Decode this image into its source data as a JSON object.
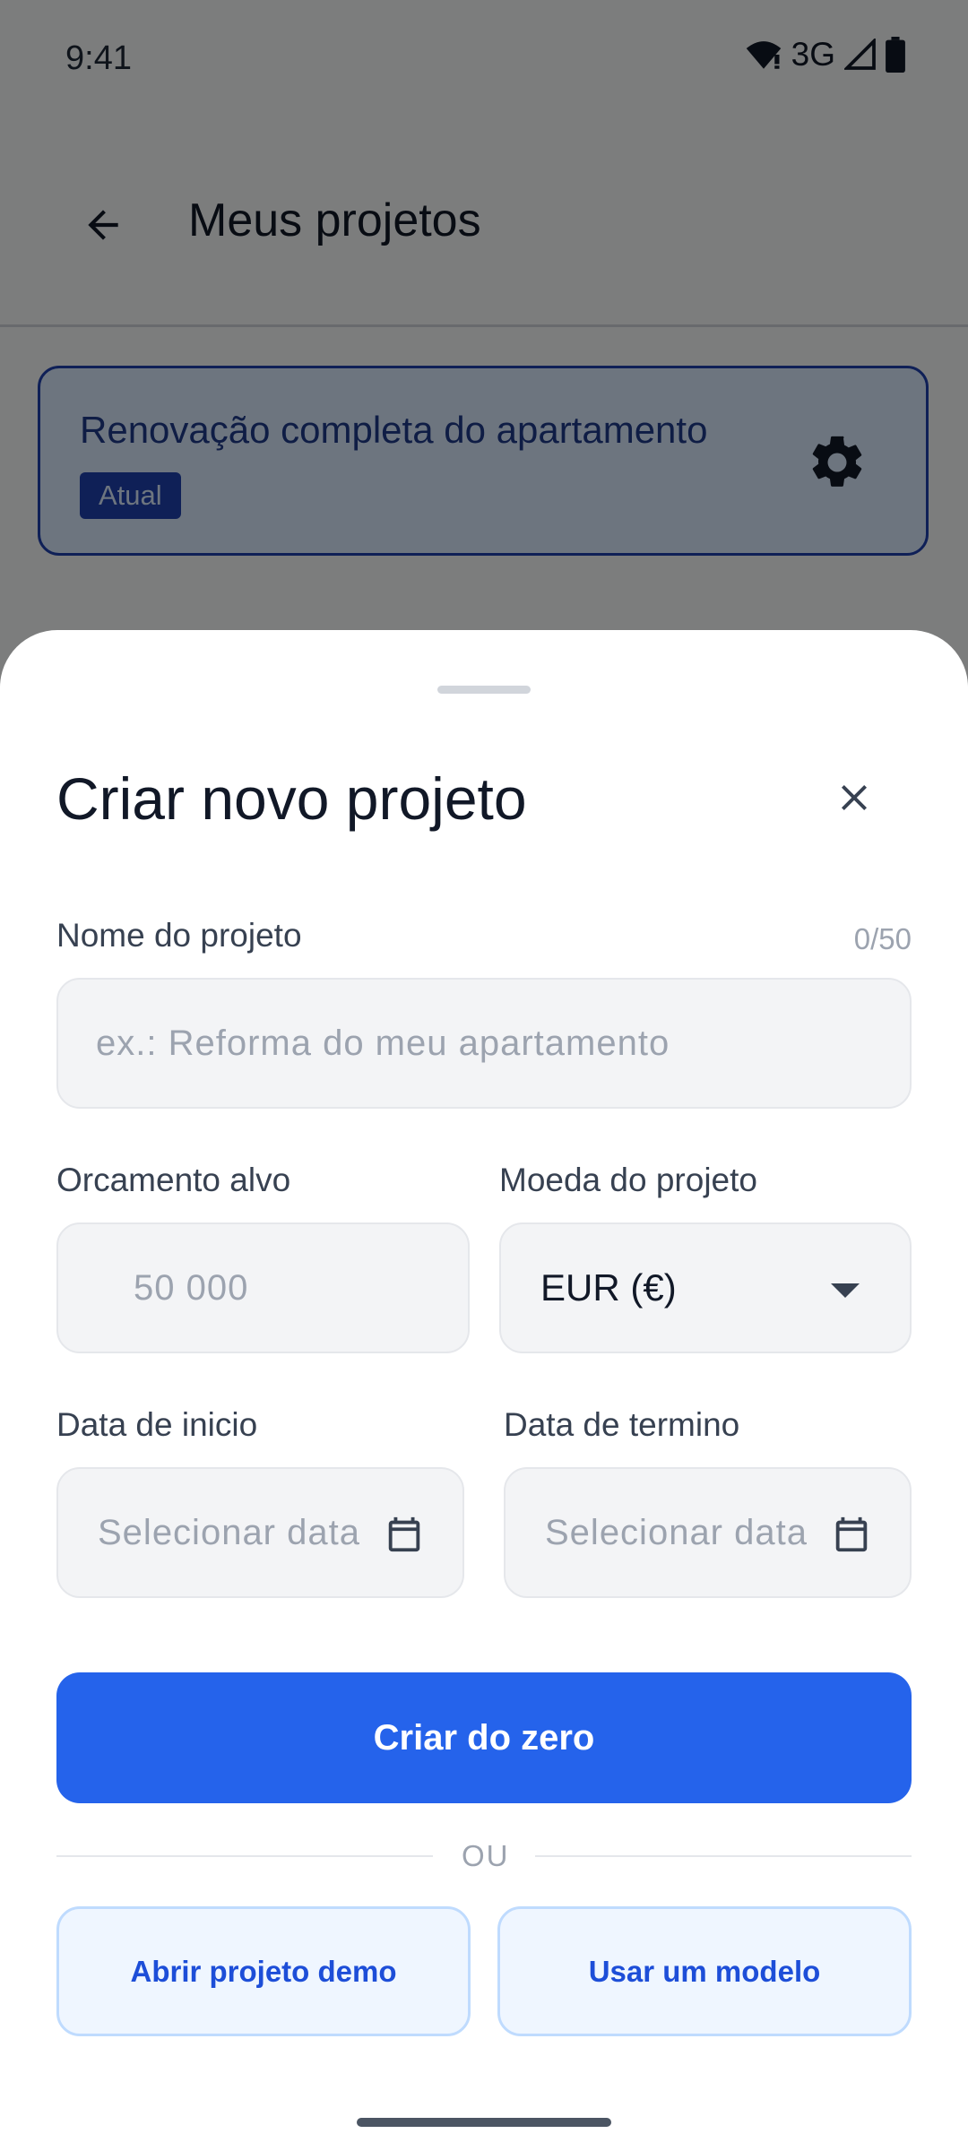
{
  "status_bar": {
    "time": "9:41",
    "network": "3G"
  },
  "background": {
    "app_bar": {
      "title": "Meus projetos"
    },
    "project_card": {
      "name": "Renovação completa do apartamento",
      "badge": "Atual"
    }
  },
  "sheet": {
    "title": "Criar novo projeto",
    "project_name": {
      "label": "Nome do projeto",
      "counter": "0/50",
      "placeholder": "ex.: Reforma do meu apartamento",
      "value": ""
    },
    "budget": {
      "label": "Orcamento alvo",
      "placeholder": "50 000",
      "value": ""
    },
    "currency": {
      "label": "Moeda do projeto",
      "selected": "EUR (€)"
    },
    "start_date": {
      "label": "Data de inicio",
      "placeholder": "Selecionar data"
    },
    "end_date": {
      "label": "Data de termino",
      "placeholder": "Selecionar data"
    },
    "create_button": "Criar do zero",
    "divider": "OU",
    "demo_button": "Abrir projeto demo",
    "template_button": "Usar um modelo"
  },
  "colors": {
    "primary": "#2563eb",
    "badge": "#1e40af",
    "card_bg": "#dbeafe"
  }
}
